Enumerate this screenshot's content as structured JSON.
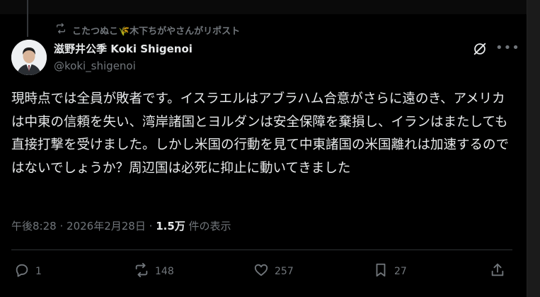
{
  "repost": {
    "text": "こたつぬこ🌾木下ちがやさんがリポスト"
  },
  "author": {
    "display_name": "滋野井公季 Koki Shigenoi",
    "handle": "@koki_shigenoi"
  },
  "post": {
    "text": "現時点では全員が敗者です。イスラエルはアブラハム合意がさらに遠のき、アメリカは中東の信頼を失い、湾岸諸国とヨルダンは安全保障を棄損し、イランはまたしても直接打撃を受けました。しかし米国の行動を見て中東諸国の米国離れは加速するのではないでしょうか？周辺国は必死に抑止に動いてきました"
  },
  "meta": {
    "time": "午後8:28",
    "date": "2026年2月28日",
    "views_count": "1.5万",
    "views_label": "件の表示",
    "separator": "·"
  },
  "actions": {
    "reply_count": "1",
    "repost_count": "148",
    "like_count": "257",
    "bookmark_count": "27"
  },
  "icons": {
    "repost_header": "repost-icon",
    "grok": "grok-icon",
    "more": "more-icon",
    "reply": "reply-icon",
    "repost": "repost-icon",
    "like": "heart-icon",
    "bookmark": "bookmark-icon",
    "share": "share-icon"
  },
  "colors": {
    "background": "#000000",
    "text_primary": "#e7e9ea",
    "text_secondary": "#71767b",
    "divider": "#2f3336"
  }
}
